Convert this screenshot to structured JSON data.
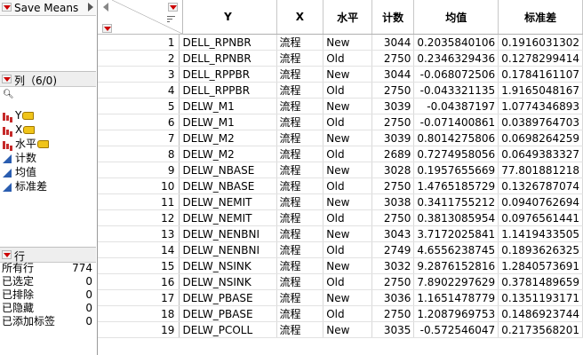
{
  "script_panel": {
    "label": "Save Means"
  },
  "columns_panel": {
    "header": "列（6/0)",
    "search_icon": "magnifier-icon",
    "items": [
      {
        "label": "Y",
        "icon": "nominal-bar-icon",
        "has_tag": true
      },
      {
        "label": "X",
        "icon": "nominal-bar-icon",
        "has_tag": true
      },
      {
        "label": "水平",
        "icon": "nominal-bar-icon",
        "has_tag": true
      },
      {
        "label": "计数",
        "icon": "continuous-triangle-icon",
        "has_tag": false
      },
      {
        "label": "均值",
        "icon": "continuous-triangle-icon",
        "has_tag": false
      },
      {
        "label": "标准差",
        "icon": "continuous-triangle-icon",
        "has_tag": false
      }
    ]
  },
  "rows_panel": {
    "header": "行",
    "stats": [
      {
        "label": "所有行",
        "value": "774"
      },
      {
        "label": "已选定",
        "value": "0"
      },
      {
        "label": "已排除",
        "value": "0"
      },
      {
        "label": "已隐藏",
        "value": "0"
      },
      {
        "label": "已添加标签",
        "value": "0"
      }
    ]
  },
  "table": {
    "headers": [
      "Y",
      "X",
      "水平",
      "计数",
      "均值",
      "标准差"
    ],
    "rows": [
      [
        "1",
        "DELL_RPNBR",
        "流程",
        "New",
        "3044",
        "0.2035840106",
        "0.1916031302"
      ],
      [
        "2",
        "DELL_RPNBR",
        "流程",
        "Old",
        "2750",
        "0.2346329436",
        "0.1278299414"
      ],
      [
        "3",
        "DELL_RPPBR",
        "流程",
        "New",
        "3044",
        "-0.068072506",
        "0.1784161107"
      ],
      [
        "4",
        "DELL_RPPBR",
        "流程",
        "Old",
        "2750",
        "-0.043321135",
        "1.9165048167"
      ],
      [
        "5",
        "DELW_M1",
        "流程",
        "New",
        "3039",
        "-0.04387197",
        "1.0774346893"
      ],
      [
        "6",
        "DELW_M1",
        "流程",
        "Old",
        "2750",
        "-0.071400861",
        "0.0389764703"
      ],
      [
        "7",
        "DELW_M2",
        "流程",
        "New",
        "3039",
        "0.8014275806",
        "0.0698264259"
      ],
      [
        "8",
        "DELW_M2",
        "流程",
        "Old",
        "2689",
        "0.7274958056",
        "0.0649383327"
      ],
      [
        "9",
        "DELW_NBASE",
        "流程",
        "New",
        "3028",
        "0.1957655669",
        "77.801881218"
      ],
      [
        "10",
        "DELW_NBASE",
        "流程",
        "Old",
        "2750",
        "1.4765185729",
        "0.1326787074"
      ],
      [
        "11",
        "DELW_NEMIT",
        "流程",
        "New",
        "3038",
        "0.3411755212",
        "0.0940762694"
      ],
      [
        "12",
        "DELW_NEMIT",
        "流程",
        "Old",
        "2750",
        "0.3813085954",
        "0.0976561441"
      ],
      [
        "13",
        "DELW_NENBNI",
        "流程",
        "New",
        "3043",
        "3.7172025841",
        "1.1419433505"
      ],
      [
        "14",
        "DELW_NENBNI",
        "流程",
        "Old",
        "2749",
        "4.6556238745",
        "0.1893626325"
      ],
      [
        "15",
        "DELW_NSINK",
        "流程",
        "New",
        "3032",
        "9.2876152816",
        "1.2840573691"
      ],
      [
        "16",
        "DELW_NSINK",
        "流程",
        "Old",
        "2750",
        "7.8902297629",
        "0.3781489659"
      ],
      [
        "17",
        "DELW_PBASE",
        "流程",
        "New",
        "3036",
        "1.1651478779",
        "0.1351193171"
      ],
      [
        "18",
        "DELW_PBASE",
        "流程",
        "Old",
        "2750",
        "1.2087969753",
        "0.1486923744"
      ],
      [
        "19",
        "DELW_PCOLL",
        "流程",
        "New",
        "3035",
        "-0.572546047",
        "0.2173568201"
      ]
    ]
  }
}
